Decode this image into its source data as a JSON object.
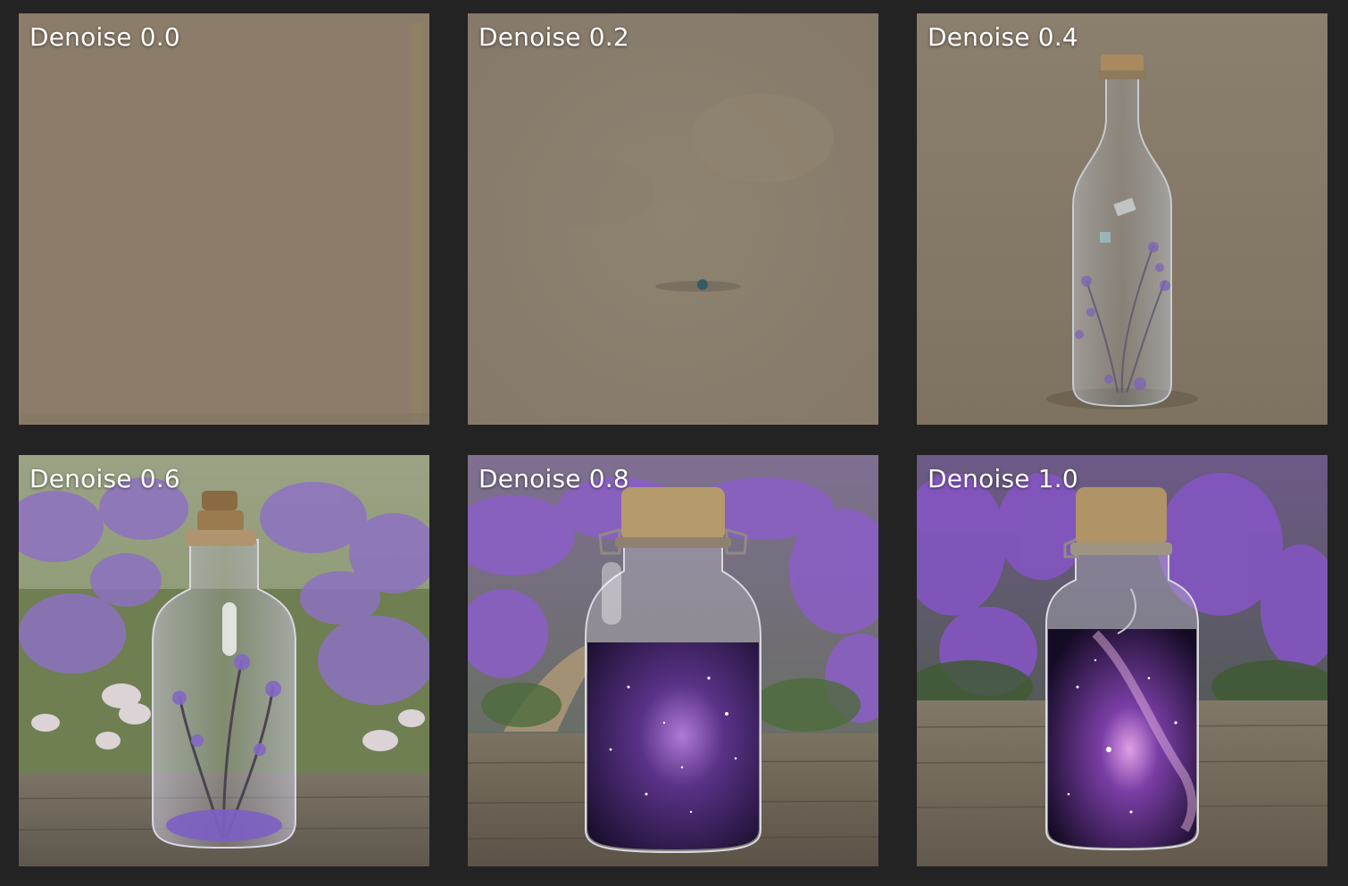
{
  "panels": [
    {
      "label": "Denoise 0.0"
    },
    {
      "label": "Denoise 0.2"
    },
    {
      "label": "Denoise 0.4"
    },
    {
      "label": "Denoise 0.6"
    },
    {
      "label": "Denoise 0.8"
    },
    {
      "label": "Denoise 1.0"
    }
  ],
  "colors": {
    "background": "#232323",
    "canvas_beige": "#8b7d6a",
    "lavender": "#8a5fc4",
    "wood": "#7d7264",
    "cork": "#a88a5e",
    "galaxy_dark": "#1a1026",
    "galaxy_purple": "#9b59d0"
  }
}
